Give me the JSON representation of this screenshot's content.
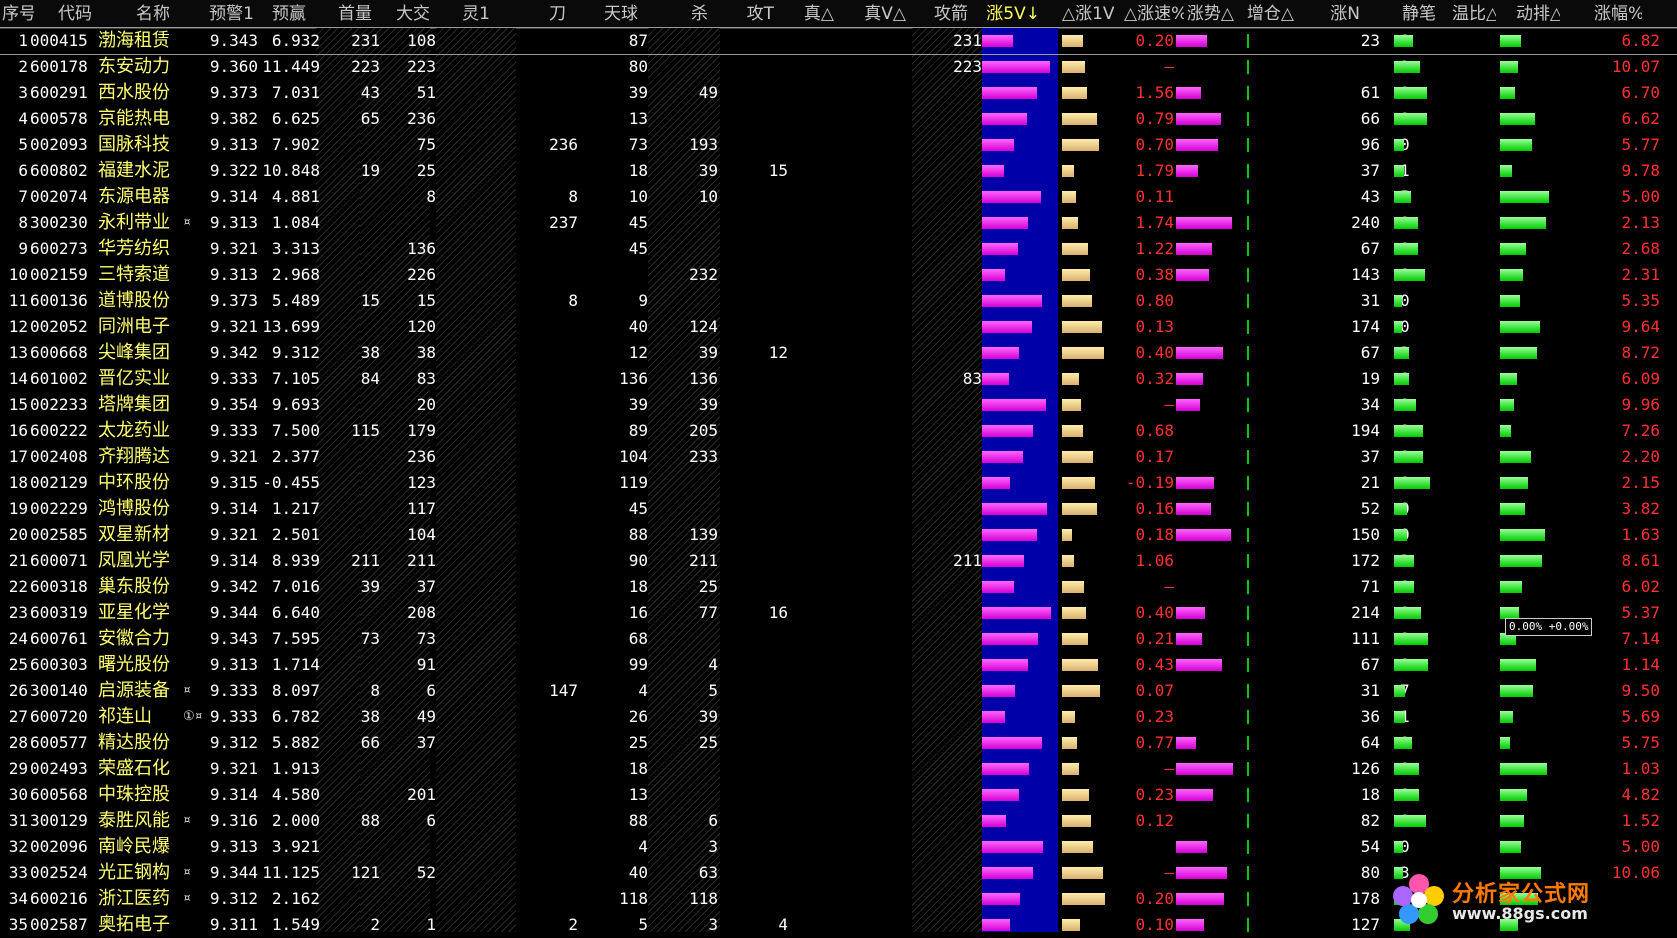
{
  "colors": {
    "band": "#0000a8",
    "up": "#ff3030",
    "name": "#ffff70",
    "sort": "#ffff55",
    "pink": "#e000e0",
    "green": "#00cc00",
    "tan": "#e0c080"
  },
  "headers": [
    "序号",
    "代码",
    "名称",
    "预警1",
    "预赢",
    "首量",
    "大交",
    "灵1",
    "刀",
    "天球",
    "杀",
    "攻T",
    "真△",
    "真V△",
    "攻箭",
    "涨5V↓",
    "△涨1V",
    "△涨速%",
    "涨势△",
    "增仓△",
    "涨N",
    "静笔",
    "温比△",
    "动排△",
    "涨幅%"
  ],
  "logo": {
    "text": "分析家公式网",
    "url": "www.88gs.com"
  },
  "tooltip": {
    "text": "0.00% +0.00%"
  },
  "rows": [
    {
      "seq": "1",
      "code": "000415",
      "name": "渤海租赁",
      "mark": "",
      "p1": "9.343",
      "win": "6.932",
      "sl": "231",
      "dj": "108",
      "l1": "",
      "dao": "",
      "tq": "87",
      "sha": "",
      "gt": "",
      "zv": "",
      "gj": "231",
      "zs": "0.20",
      "zn": "23",
      "jb": "1",
      "zf": "6.82"
    },
    {
      "seq": "2",
      "code": "600178",
      "name": "东安动力",
      "mark": "",
      "p1": "9.360",
      "win": "11.449",
      "sl": "223",
      "dj": "223",
      "l1": "",
      "dao": "",
      "tq": "80",
      "sha": "",
      "gt": "",
      "zv": "",
      "gj": "223",
      "zs": "–",
      "zn": "",
      "jb": "2",
      "zf": "10.07"
    },
    {
      "seq": "3",
      "code": "600291",
      "name": "西水股份",
      "mark": "",
      "p1": "9.373",
      "win": "7.031",
      "sl": "43",
      "dj": "51",
      "l1": "",
      "dao": "",
      "tq": "39",
      "sha": "49",
      "gt": "",
      "zv": "",
      "gj": "",
      "zs": "1.56",
      "zn": "61",
      "jb": "0",
      "zf": "6.70"
    },
    {
      "seq": "4",
      "code": "600578",
      "name": "京能热电",
      "mark": "",
      "p1": "9.382",
      "win": "6.625",
      "sl": "65",
      "dj": "236",
      "l1": "",
      "dao": "",
      "tq": "13",
      "sha": "",
      "gt": "",
      "zv": "",
      "gj": "",
      "zs": "0.79",
      "zn": "66",
      "jb": "0",
      "zf": "6.62"
    },
    {
      "seq": "5",
      "code": "002093",
      "name": "国脉科技",
      "mark": "",
      "p1": "9.313",
      "win": "7.902",
      "sl": "",
      "dj": "75",
      "l1": "",
      "dao": "236",
      "tq": "73",
      "sha": "193",
      "gt": "",
      "zv": "",
      "gj": "",
      "zs": "0.70",
      "zn": "96",
      "jb": "0",
      "zf": "5.77"
    },
    {
      "seq": "6",
      "code": "600802",
      "name": "福建水泥",
      "mark": "",
      "p1": "9.322",
      "win": "10.848",
      "sl": "19",
      "dj": "25",
      "l1": "",
      "dao": "",
      "tq": "18",
      "sha": "39",
      "gt": "15",
      "zv": "",
      "gj": "",
      "zs": "1.79",
      "zn": "37",
      "jb": "1",
      "zf": "9.78"
    },
    {
      "seq": "7",
      "code": "002074",
      "name": "东源电器",
      "mark": "",
      "p1": "9.314",
      "win": "4.881",
      "sl": "",
      "dj": "8",
      "l1": "",
      "dao": "8",
      "tq": "10",
      "sha": "10",
      "gt": "",
      "zv": "",
      "gj": "",
      "zs": "0.11",
      "zn": "43",
      "jb": "5",
      "zf": "5.00"
    },
    {
      "seq": "8",
      "code": "300230",
      "name": "永利带业",
      "mark": "¤",
      "p1": "9.313",
      "win": "1.084",
      "sl": "",
      "dj": "",
      "l1": "",
      "dao": "237",
      "tq": "45",
      "sha": "",
      "gt": "",
      "zv": "",
      "gj": "",
      "zs": "1.74",
      "zn": "240",
      "jb": "0",
      "zf": "2.13"
    },
    {
      "seq": "9",
      "code": "600273",
      "name": "华芳纺织",
      "mark": "",
      "p1": "9.321",
      "win": "3.313",
      "sl": "",
      "dj": "136",
      "l1": "",
      "dao": "",
      "tq": "45",
      "sha": "",
      "gt": "",
      "zv": "",
      "gj": "",
      "zs": "1.22",
      "zn": "67",
      "jb": "0",
      "zf": "2.68"
    },
    {
      "seq": "10",
      "code": "002159",
      "name": "三特索道",
      "mark": "",
      "p1": "9.313",
      "win": "2.968",
      "sl": "",
      "dj": "226",
      "l1": "",
      "dao": "",
      "tq": "",
      "sha": "232",
      "gt": "",
      "zv": "",
      "gj": "",
      "zs": "0.38",
      "zn": "143",
      "jb": "1",
      "zf": "2.31"
    },
    {
      "seq": "11",
      "code": "600136",
      "name": "道博股份",
      "mark": "",
      "p1": "9.373",
      "win": "5.489",
      "sl": "15",
      "dj": "15",
      "l1": "",
      "dao": "8",
      "tq": "9",
      "sha": "",
      "gt": "",
      "zv": "",
      "gj": "",
      "zs": "0.80",
      "zn": "31",
      "jb": "0",
      "zf": "5.35"
    },
    {
      "seq": "12",
      "code": "002052",
      "name": "同洲电子",
      "mark": "",
      "p1": "9.321",
      "win": "13.699",
      "sl": "",
      "dj": "120",
      "l1": "",
      "dao": "",
      "tq": "40",
      "sha": "124",
      "gt": "",
      "zv": "",
      "gj": "",
      "zs": "0.13",
      "zn": "174",
      "jb": "0",
      "zf": "9.64"
    },
    {
      "seq": "13",
      "code": "600668",
      "name": "尖峰集团",
      "mark": "",
      "p1": "9.342",
      "win": "9.312",
      "sl": "38",
      "dj": "38",
      "l1": "",
      "dao": "",
      "tq": "12",
      "sha": "39",
      "gt": "12",
      "zv": "",
      "gj": "",
      "zs": "0.40",
      "zn": "67",
      "jb": "3",
      "zf": "8.72"
    },
    {
      "seq": "14",
      "code": "601002",
      "name": "晋亿实业",
      "mark": "",
      "p1": "9.333",
      "win": "7.105",
      "sl": "84",
      "dj": "83",
      "l1": "",
      "dao": "",
      "tq": "136",
      "sha": "136",
      "gt": "",
      "zv": "",
      "gj": "83",
      "zs": "0.32",
      "zn": "19",
      "jb": "0",
      "zf": "6.09"
    },
    {
      "seq": "15",
      "code": "002233",
      "name": "塔牌集团",
      "mark": "",
      "p1": "9.354",
      "win": "9.693",
      "sl": "",
      "dj": "20",
      "l1": "",
      "dao": "",
      "tq": "39",
      "sha": "39",
      "gt": "",
      "zv": "",
      "gj": "",
      "zs": "–",
      "zn": "34",
      "jb": "9",
      "zf": "9.96"
    },
    {
      "seq": "16",
      "code": "600222",
      "name": "太龙药业",
      "mark": "",
      "p1": "9.333",
      "win": "7.500",
      "sl": "115",
      "dj": "179",
      "l1": "",
      "dao": "",
      "tq": "89",
      "sha": "205",
      "gt": "",
      "zv": "",
      "gj": "",
      "zs": "0.68",
      "zn": "194",
      "jb": "1",
      "zf": "7.26"
    },
    {
      "seq": "17",
      "code": "002408",
      "name": "齐翔腾达",
      "mark": "",
      "p1": "9.321",
      "win": "2.377",
      "sl": "",
      "dj": "236",
      "l1": "",
      "dao": "",
      "tq": "104",
      "sha": "233",
      "gt": "",
      "zv": "",
      "gj": "",
      "zs": "0.17",
      "zn": "37",
      "jb": "0",
      "zf": "2.20"
    },
    {
      "seq": "18",
      "code": "002129",
      "name": "中环股份",
      "mark": "",
      "p1": "9.315",
      "win": "-0.455",
      "sl": "",
      "dj": "123",
      "l1": "",
      "dao": "",
      "tq": "119",
      "sha": "",
      "gt": "",
      "zv": "",
      "gj": "",
      "zs": "-0.19",
      "zn": "21",
      "jb": "0",
      "zf": "2.15"
    },
    {
      "seq": "19",
      "code": "002229",
      "name": "鸿博股份",
      "mark": "",
      "p1": "9.314",
      "win": "1.217",
      "sl": "",
      "dj": "117",
      "l1": "",
      "dao": "",
      "tq": "45",
      "sha": "",
      "gt": "",
      "zv": "",
      "gj": "",
      "zs": "0.16",
      "zn": "52",
      "jb": "0",
      "zf": "3.82"
    },
    {
      "seq": "20",
      "code": "002585",
      "name": "双星新材",
      "mark": "",
      "p1": "9.321",
      "win": "2.501",
      "sl": "",
      "dj": "104",
      "l1": "",
      "dao": "",
      "tq": "88",
      "sha": "139",
      "gt": "",
      "zv": "",
      "gj": "",
      "zs": "0.18",
      "zn": "150",
      "jb": "0",
      "zf": "1.63"
    },
    {
      "seq": "21",
      "code": "600071",
      "name": "凤凰光学",
      "mark": "",
      "p1": "9.314",
      "win": "8.939",
      "sl": "211",
      "dj": "211",
      "l1": "",
      "dao": "",
      "tq": "90",
      "sha": "211",
      "gt": "",
      "zv": "",
      "gj": "211",
      "zs": "1.06",
      "zn": "172",
      "jb": "3",
      "zf": "8.61"
    },
    {
      "seq": "22",
      "code": "600318",
      "name": "巢东股份",
      "mark": "",
      "p1": "9.342",
      "win": "7.016",
      "sl": "39",
      "dj": "37",
      "l1": "",
      "dao": "",
      "tq": "18",
      "sha": "25",
      "gt": "",
      "zv": "",
      "gj": "",
      "zs": "–",
      "zn": "71",
      "jb": "0",
      "zf": "6.02"
    },
    {
      "seq": "23",
      "code": "600319",
      "name": "亚星化学",
      "mark": "",
      "p1": "9.344",
      "win": "6.640",
      "sl": "",
      "dj": "208",
      "l1": "",
      "dao": "",
      "tq": "16",
      "sha": "77",
      "gt": "16",
      "zv": "",
      "gj": "",
      "zs": "0.40",
      "zn": "214",
      "jb": "0",
      "zf": "5.37"
    },
    {
      "seq": "24",
      "code": "600761",
      "name": "安徽合力",
      "mark": "",
      "p1": "9.343",
      "win": "7.595",
      "sl": "73",
      "dj": "73",
      "l1": "",
      "dao": "",
      "tq": "68",
      "sha": "",
      "gt": "",
      "zv": "",
      "gj": "",
      "zs": "0.21",
      "zn": "111",
      "jb": "1",
      "zf": "7.14"
    },
    {
      "seq": "25",
      "code": "600303",
      "name": "曙光股份",
      "mark": "",
      "p1": "9.313",
      "win": "1.714",
      "sl": "",
      "dj": "91",
      "l1": "",
      "dao": "",
      "tq": "99",
      "sha": "4",
      "gt": "",
      "zv": "",
      "gj": "",
      "zs": "0.43",
      "zn": "67",
      "jb": "0",
      "zf": "1.14"
    },
    {
      "seq": "26",
      "code": "300140",
      "name": "启源装备",
      "mark": "¤",
      "p1": "9.333",
      "win": "8.097",
      "sl": "8",
      "dj": "6",
      "l1": "",
      "dao": "147",
      "tq": "4",
      "sha": "5",
      "gt": "",
      "zv": "",
      "gj": "",
      "zs": "0.07",
      "zn": "31",
      "jb": "7",
      "zf": "9.50"
    },
    {
      "seq": "27",
      "code": "600720",
      "name": "祁连山",
      "mark": "①¤",
      "p1": "9.333",
      "win": "6.782",
      "sl": "38",
      "dj": "49",
      "l1": "",
      "dao": "",
      "tq": "26",
      "sha": "39",
      "gt": "",
      "zv": "",
      "gj": "",
      "zs": "0.23",
      "zn": "36",
      "jb": "1",
      "zf": "5.69"
    },
    {
      "seq": "28",
      "code": "600577",
      "name": "精达股份",
      "mark": "",
      "p1": "9.312",
      "win": "5.882",
      "sl": "66",
      "dj": "37",
      "l1": "",
      "dao": "",
      "tq": "25",
      "sha": "25",
      "gt": "",
      "zv": "",
      "gj": "",
      "zs": "0.77",
      "zn": "64",
      "jb": "0",
      "zf": "5.75"
    },
    {
      "seq": "29",
      "code": "002493",
      "name": "荣盛石化",
      "mark": "",
      "p1": "9.321",
      "win": "1.913",
      "sl": "",
      "dj": "",
      "l1": "",
      "dao": "",
      "tq": "18",
      "sha": "",
      "gt": "",
      "zv": "",
      "gj": "",
      "zs": "–",
      "zn": "126",
      "jb": "0",
      "zf": "1.03"
    },
    {
      "seq": "30",
      "code": "600568",
      "name": "中珠控股",
      "mark": "",
      "p1": "9.314",
      "win": "4.580",
      "sl": "",
      "dj": "201",
      "l1": "",
      "dao": "",
      "tq": "13",
      "sha": "",
      "gt": "",
      "zv": "",
      "gj": "",
      "zs": "0.23",
      "zn": "18",
      "jb": "0",
      "zf": "4.82"
    },
    {
      "seq": "31",
      "code": "300129",
      "name": "泰胜风能",
      "mark": "¤",
      "p1": "9.316",
      "win": "2.000",
      "sl": "88",
      "dj": "6",
      "l1": "",
      "dao": "",
      "tq": "88",
      "sha": "6",
      "gt": "",
      "zv": "",
      "gj": "",
      "zs": "0.12",
      "zn": "82",
      "jb": "1",
      "zf": "1.52"
    },
    {
      "seq": "32",
      "code": "002096",
      "name": "南岭民爆",
      "mark": "",
      "p1": "9.313",
      "win": "3.921",
      "sl": "",
      "dj": "",
      "l1": "",
      "dao": "",
      "tq": "4",
      "sha": "3",
      "gt": "",
      "zv": "",
      "gj": "",
      "zs": "",
      "zn": "54",
      "jb": "0",
      "zf": "5.00"
    },
    {
      "seq": "33",
      "code": "002524",
      "name": "光正钢构",
      "mark": "¤",
      "p1": "9.344",
      "win": "11.125",
      "sl": "121",
      "dj": "52",
      "l1": "",
      "dao": "",
      "tq": "40",
      "sha": "63",
      "gt": "",
      "zv": "",
      "gj": "",
      "zs": "–",
      "zn": "80",
      "jb": "3",
      "zf": "10.06"
    },
    {
      "seq": "34",
      "code": "600216",
      "name": "浙江医药",
      "mark": "¤",
      "p1": "9.312",
      "win": "2.162",
      "sl": "",
      "dj": "",
      "l1": "",
      "dao": "",
      "tq": "118",
      "sha": "118",
      "gt": "",
      "zv": "",
      "gj": "",
      "zs": "0.20",
      "zn": "178",
      "jb": "0",
      "zf": ""
    },
    {
      "seq": "35",
      "code": "002587",
      "name": "奥拓电子",
      "mark": "",
      "p1": "9.311",
      "win": "1.549",
      "sl": "2",
      "dj": "1",
      "l1": "",
      "dao": "2",
      "tq": "5",
      "sha": "3",
      "gt": "4",
      "zv": "",
      "gj": "",
      "zs": "0.10",
      "zn": "127",
      "jb": "5",
      "zf": ""
    }
  ]
}
